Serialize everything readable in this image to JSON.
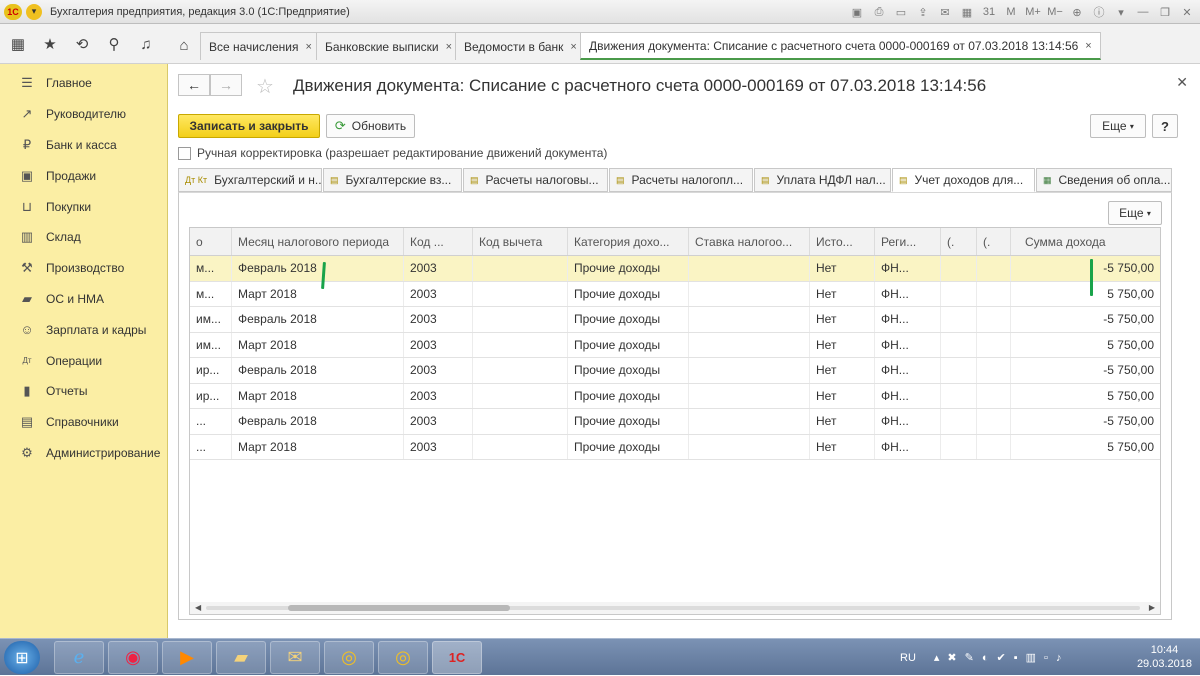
{
  "window": {
    "title": "Бухгалтерия предприятия, редакция 3.0  (1С:Предприятие)",
    "logo_text": "1С"
  },
  "tabs": [
    {
      "label": "Все начисления",
      "close": "×"
    },
    {
      "label": "Банковские выписки",
      "close": "×"
    },
    {
      "label": "Ведомости в банк",
      "close": "×"
    },
    {
      "label": "Движения документа: Списание с расчетного счета 0000-000169 от 07.03.2018 13:14:56",
      "close": "×"
    }
  ],
  "sidebar": {
    "items": [
      {
        "label": "Главное",
        "icon": "menu-icon"
      },
      {
        "label": "Руководителю",
        "icon": "trend-icon"
      },
      {
        "label": "Банк и касса",
        "icon": "ruble-icon"
      },
      {
        "label": "Продажи",
        "icon": "cart-icon"
      },
      {
        "label": "Покупки",
        "icon": "basket-icon"
      },
      {
        "label": "Склад",
        "icon": "warehouse-icon"
      },
      {
        "label": "Производство",
        "icon": "factory-icon"
      },
      {
        "label": "ОС и НМА",
        "icon": "assets-icon"
      },
      {
        "label": "Зарплата и кадры",
        "icon": "people-icon"
      },
      {
        "label": "Операции",
        "icon": "dt-kt-icon"
      },
      {
        "label": "Отчеты",
        "icon": "bar-chart-icon"
      },
      {
        "label": "Справочники",
        "icon": "book-icon"
      },
      {
        "label": "Администрирование",
        "icon": "gear-icon"
      }
    ]
  },
  "document": {
    "title": "Движения документа: Списание с расчетного счета 0000-000169 от 07.03.2018 13:14:56",
    "save_close_label": "Записать и закрыть",
    "refresh_label": "Обновить",
    "more_label": "Еще",
    "help_label": "?",
    "manual_edit_label": "Ручная корректировка (разрешает редактирование движений документа)",
    "manual_edit_checked": false
  },
  "subtabs": [
    {
      "label": "Бухгалтерский и н...",
      "icon": "Дт Кт"
    },
    {
      "label": "Бухгалтерские вз...",
      "icon": "▤"
    },
    {
      "label": "Расчеты налоговы...",
      "icon": "▤"
    },
    {
      "label": "Расчеты налогопл...",
      "icon": "▤"
    },
    {
      "label": "Уплата НДФЛ нал...",
      "icon": "▤"
    },
    {
      "label": "Учет доходов для...",
      "icon": "▤",
      "active": true
    },
    {
      "label": "Сведения об опла...",
      "icon": "▦"
    }
  ],
  "grid": {
    "more_label": "Еще",
    "columns": [
      "о",
      "Месяц налогового периода",
      "Код ...",
      "Код вычета",
      "Категория дохо...",
      "Ставка налогоо...",
      "Исто...",
      "Реги...",
      "(.",
      "(.",
      "Сумма дохода"
    ],
    "rows": [
      [
        "м...",
        "Февраль 2018",
        "2003",
        "",
        "Прочие доходы",
        "",
        "Нет",
        "ФН...",
        "",
        "",
        "-5 750,00"
      ],
      [
        "м...",
        "Март 2018",
        "2003",
        "",
        "Прочие доходы",
        "",
        "Нет",
        "ФН...",
        "",
        "",
        "5 750,00"
      ],
      [
        "им...",
        "Февраль 2018",
        "2003",
        "",
        "Прочие доходы",
        "",
        "Нет",
        "ФН...",
        "",
        "",
        "-5 750,00"
      ],
      [
        "им...",
        "Март 2018",
        "2003",
        "",
        "Прочие доходы",
        "",
        "Нет",
        "ФН...",
        "",
        "",
        "5 750,00"
      ],
      [
        "ир...",
        "Февраль 2018",
        "2003",
        "",
        "Прочие доходы",
        "",
        "Нет",
        "ФН...",
        "",
        "",
        "-5 750,00"
      ],
      [
        "ир...",
        "Март 2018",
        "2003",
        "",
        "Прочие доходы",
        "",
        "Нет",
        "ФН...",
        "",
        "",
        "5 750,00"
      ],
      [
        "...",
        "Февраль 2018",
        "2003",
        "",
        "Прочие доходы",
        "",
        "Нет",
        "ФН...",
        "",
        "",
        "-5 750,00"
      ],
      [
        "...",
        "Март 2018",
        "2003",
        "",
        "Прочие доходы",
        "",
        "Нет",
        "ФН...",
        "",
        "",
        "5 750,00"
      ]
    ],
    "selected_row": 0
  },
  "taskbar": {
    "lang": "RU",
    "time": "10:44",
    "date": "29.03.2018",
    "apps": [
      "ie-icon",
      "chrome-icon",
      "media-icon",
      "explorer-icon",
      "outlook-icon",
      "app-1c-icon",
      "app-1c-icon",
      "1c-enterprise-icon"
    ]
  },
  "colors": {
    "sidebar_bg": "#fbeea4",
    "primary_button": "#f3cf19",
    "selected_row": "#faf4c4",
    "active_tab_accent": "#4a9a4a",
    "annotation_marker": "#19a34a"
  }
}
